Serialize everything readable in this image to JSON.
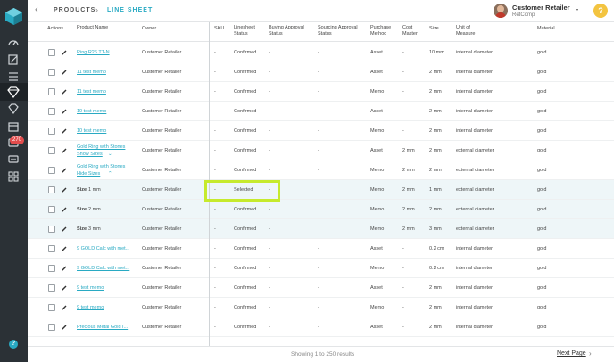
{
  "header": {
    "back": "‹",
    "breadcrumb": [
      "PRODUCTS",
      "›",
      "LINE SHEET"
    ],
    "user_name": "Customer Retailer",
    "user_company": "RetComp",
    "user_caret": "▾",
    "help": "?"
  },
  "sidebar": {
    "badge": "270",
    "help": "?"
  },
  "columns": [
    "Actions",
    "Product Name",
    "Owner",
    "SKU",
    "Linesheet Status",
    "Buying Approval Status",
    "Sourcing Approval Status",
    "Purchase Method",
    "Cost Master",
    "Size",
    "Unit of Measure",
    "Material"
  ],
  "rows": [
    {
      "product": "Ring R26 TT-N",
      "link": true,
      "owner": "Customer Retailer",
      "sku": "-",
      "status": "Confirmed",
      "buying": "-",
      "sourcing": "-",
      "method": "Asset",
      "cost": "-",
      "size": "10 mm",
      "uom": "internal diameter",
      "material": "gold"
    },
    {
      "product": "11 test memo",
      "link": true,
      "owner": "Customer Retailer",
      "sku": "-",
      "status": "Confirmed",
      "buying": "-",
      "sourcing": "-",
      "method": "Asset",
      "cost": "-",
      "size": "2 mm",
      "uom": "internal diameter",
      "material": "gold"
    },
    {
      "product": "11 test memo",
      "link": true,
      "owner": "Customer Retailer",
      "sku": "-",
      "status": "Confirmed",
      "buying": "-",
      "sourcing": "-",
      "method": "Memo",
      "cost": "-",
      "size": "2 mm",
      "uom": "internal diameter",
      "material": "gold"
    },
    {
      "product": "10 test memo",
      "link": true,
      "owner": "Customer Retailer",
      "sku": "-",
      "status": "Confirmed",
      "buying": "-",
      "sourcing": "-",
      "method": "Asset",
      "cost": "-",
      "size": "2 mm",
      "uom": "internal diameter",
      "material": "gold"
    },
    {
      "product": "10 test memo",
      "link": true,
      "owner": "Customer Retailer",
      "sku": "-",
      "status": "Confirmed",
      "buying": "-",
      "sourcing": "-",
      "method": "Memo",
      "cost": "-",
      "size": "2 mm",
      "uom": "internal diameter",
      "material": "gold"
    },
    {
      "product": "Gold Ring with Stones",
      "sub": "Show Sizes",
      "sub_icon": "⌄",
      "link": true,
      "owner": "Customer Retailer",
      "sku": "-",
      "status": "Confirmed",
      "buying": "-",
      "sourcing": "-",
      "method": "Asset",
      "cost": "2 mm",
      "size": "2 mm",
      "uom": "external diameter",
      "material": "gold"
    },
    {
      "product": "Gold Ring with Stones",
      "sub": "Hide Sizes",
      "sub_icon": "⌃",
      "link": true,
      "owner": "Customer Retailer",
      "sku": "-",
      "status": "Confirmed",
      "buying": "-",
      "sourcing": "-",
      "method": "Memo",
      "cost": "2 mm",
      "size": "2 mm",
      "uom": "external diameter",
      "material": "gold"
    },
    {
      "product": "Size",
      "size_val": "1 mm",
      "link": false,
      "sel": true,
      "owner": "Customer Retailer",
      "sku": "-",
      "status": "Selected",
      "buying": "-",
      "sourcing": "",
      "method": "Memo",
      "cost": "2 mm",
      "size": "1 mm",
      "uom": "external diameter",
      "material": "gold"
    },
    {
      "product": "Size",
      "size_val": "2 mm",
      "link": false,
      "sel": true,
      "owner": "Customer Retailer",
      "sku": "-",
      "status": "Confirmed",
      "buying": "-",
      "sourcing": "",
      "method": "Memo",
      "cost": "2 mm",
      "size": "2 mm",
      "uom": "external diameter",
      "material": "gold"
    },
    {
      "product": "Size",
      "size_val": "3 mm",
      "link": false,
      "sel": true,
      "owner": "Customer Retailer",
      "sku": "-",
      "status": "Confirmed",
      "buying": "-",
      "sourcing": "",
      "method": "Memo",
      "cost": "2 mm",
      "size": "3 mm",
      "uom": "external diameter",
      "material": "gold"
    },
    {
      "product": "9 GOLD Calc with met...",
      "link": true,
      "owner": "Customer Retailer",
      "sku": "-",
      "status": "Confirmed",
      "buying": "-",
      "sourcing": "-",
      "method": "Asset",
      "cost": "-",
      "size": "0.2 cm",
      "uom": "internal diameter",
      "material": "gold"
    },
    {
      "product": "9 GOLD Calc with met...",
      "link": true,
      "owner": "Customer Retailer",
      "sku": "-",
      "status": "Confirmed",
      "buying": "-",
      "sourcing": "-",
      "method": "Memo",
      "cost": "-",
      "size": "0.2 cm",
      "uom": "internal diameter",
      "material": "gold"
    },
    {
      "product": "9 test memo",
      "link": true,
      "owner": "Customer Retailer",
      "sku": "-",
      "status": "Confirmed",
      "buying": "-",
      "sourcing": "-",
      "method": "Asset",
      "cost": "-",
      "size": "2 mm",
      "uom": "internal diameter",
      "material": "gold"
    },
    {
      "product": "9 test memo",
      "link": true,
      "owner": "Customer Retailer",
      "sku": "-",
      "status": "Confirmed",
      "buying": "-",
      "sourcing": "-",
      "method": "Memo",
      "cost": "-",
      "size": "2 mm",
      "uom": "internal diameter",
      "material": "gold"
    },
    {
      "product": "Precious Metal Gold I...",
      "link": true,
      "owner": "Customer Retailer",
      "sku": "-",
      "status": "Confirmed",
      "buying": "-",
      "sourcing": "-",
      "method": "Asset",
      "cost": "-",
      "size": "2 mm",
      "uom": "internal diameter",
      "material": "gold"
    }
  ],
  "footer": {
    "status": "Showing 1 to 250 results",
    "next": "Next Page",
    "next_icon": "›"
  }
}
